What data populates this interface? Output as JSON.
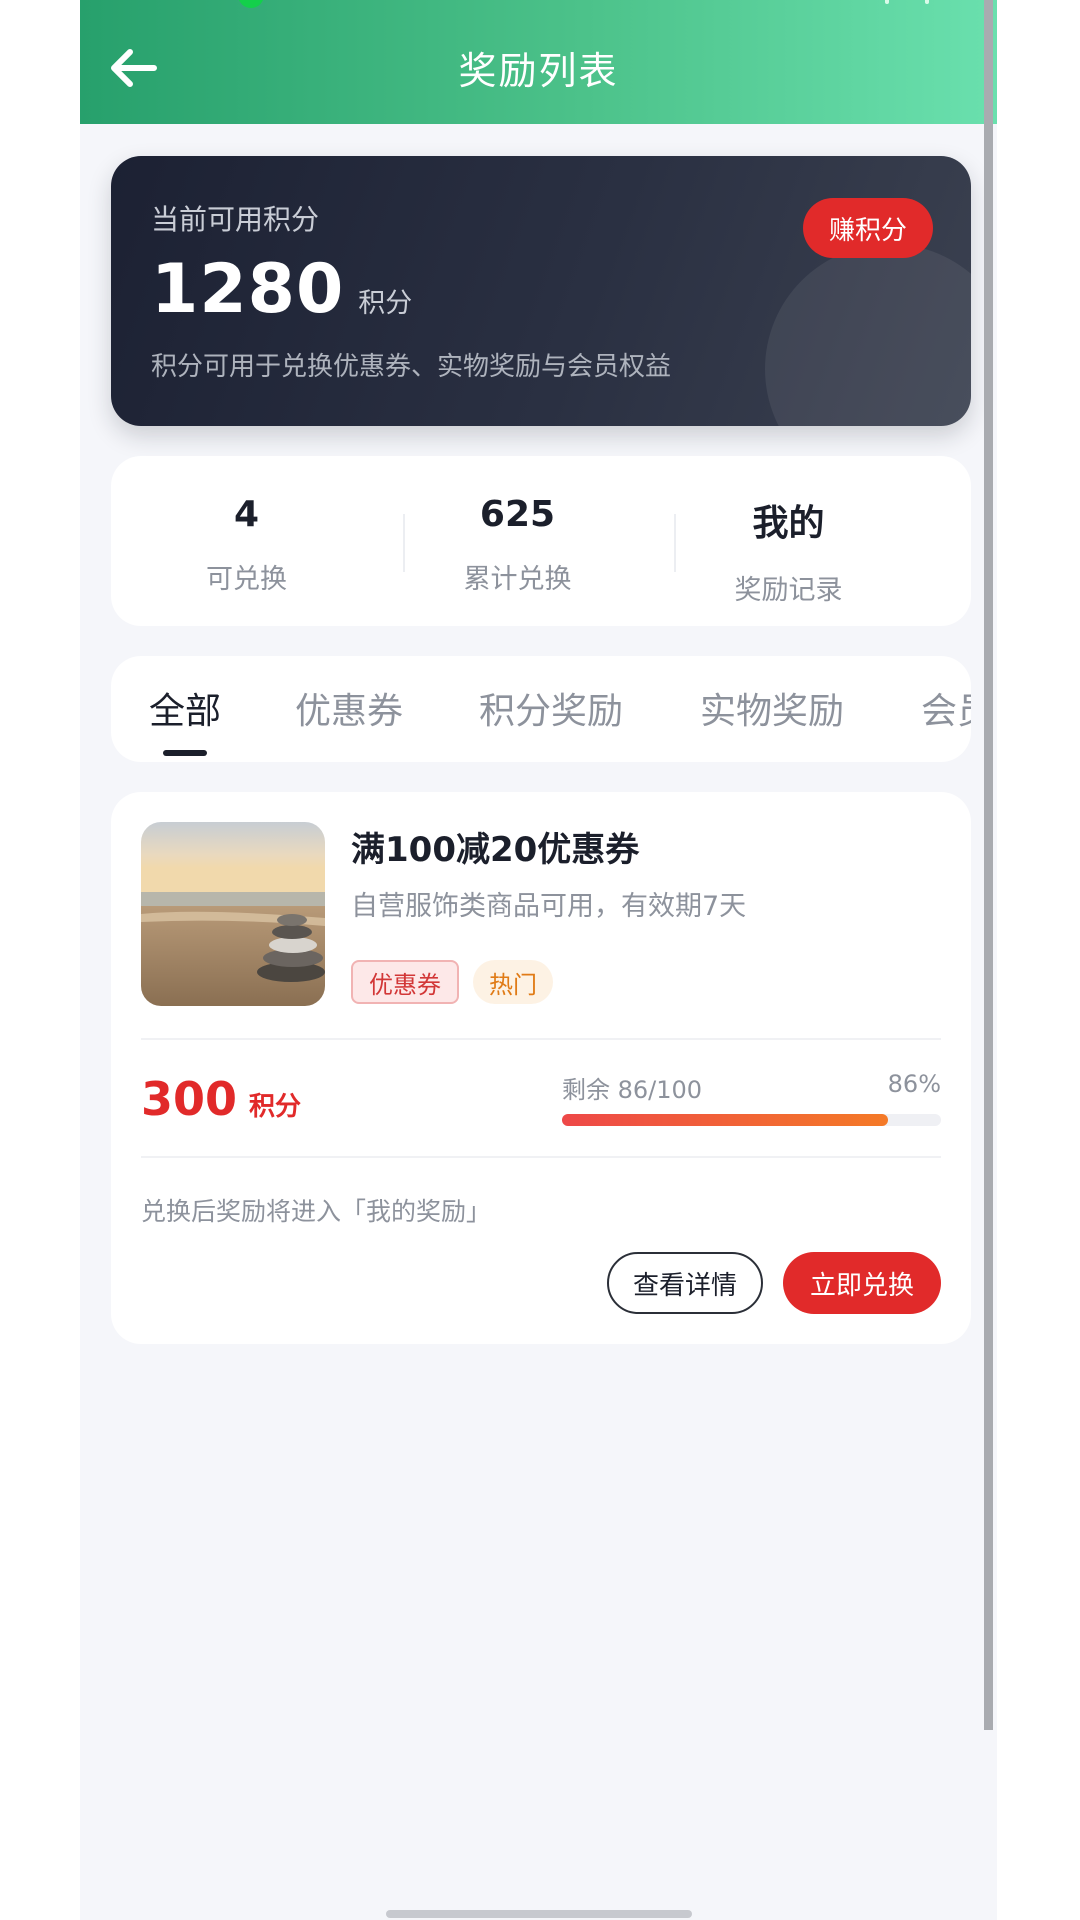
{
  "header": {
    "title": "奖励列表",
    "back_icon": "arrow-left-icon"
  },
  "points_card": {
    "label": "当前可用积分",
    "value": "1280",
    "unit": "积分",
    "description": "积分可用于兑换优惠券、实物奖励与会员权益",
    "earn_button": "赚积分"
  },
  "stats": [
    {
      "value": "4",
      "label": "可兑换"
    },
    {
      "value": "625",
      "label": "累计兑换"
    },
    {
      "value": "我的",
      "label": "奖励记录"
    }
  ],
  "tabs": [
    {
      "label": "全部",
      "active": true
    },
    {
      "label": "优惠券",
      "active": false
    },
    {
      "label": "积分奖励",
      "active": false
    },
    {
      "label": "实物奖励",
      "active": false
    },
    {
      "label": "会员",
      "active": false
    }
  ],
  "reward": {
    "title": "满100减20优惠券",
    "description": "自营服饰类商品可用，有效期7天",
    "tags": [
      "优惠券",
      "热门"
    ],
    "price": "300",
    "price_unit": "积分",
    "stock_label": "剩余 86/100",
    "stock_percent": "86%",
    "stock_fraction": 0.86,
    "note": "兑换后奖励将进入「我的奖励」",
    "detail_button": "查看详情",
    "redeem_button": "立即兑换"
  },
  "colors": {
    "header_gradient_start": "#27a06c",
    "header_gradient_end": "#6ae0ae",
    "accent_red": "#e12a2a",
    "card_dark": "#1c2133",
    "hot_tag": "#e07b16"
  }
}
